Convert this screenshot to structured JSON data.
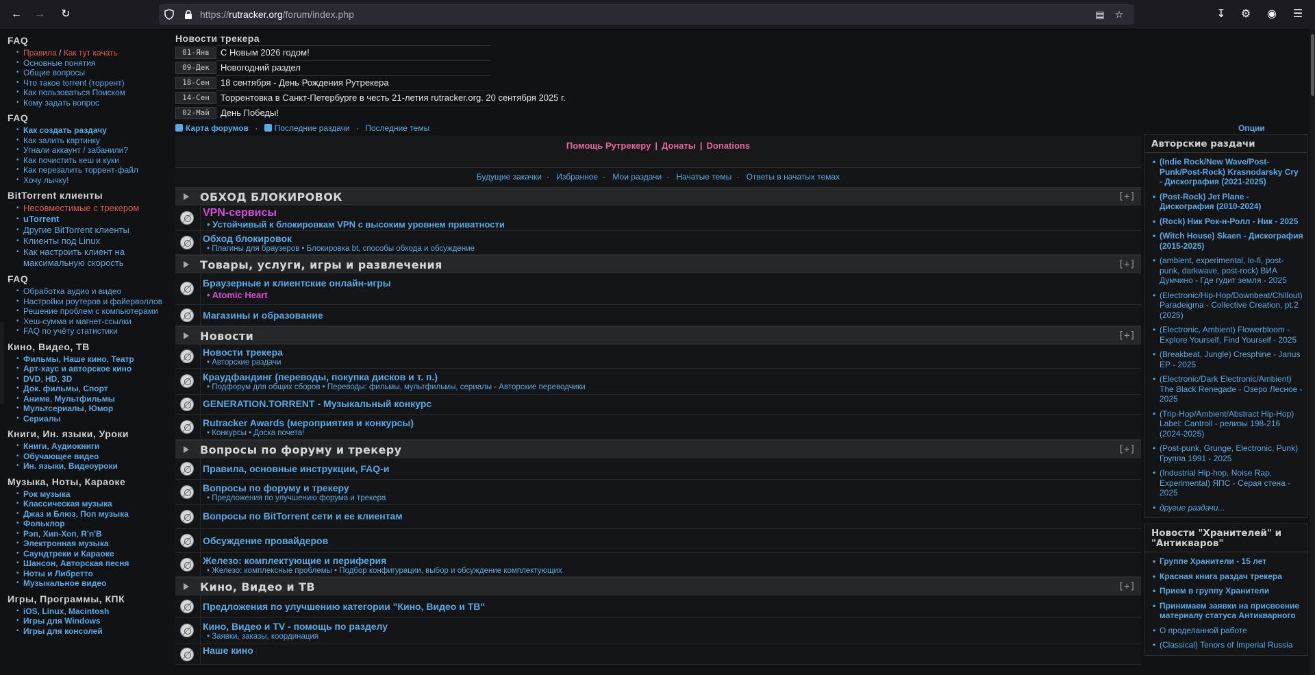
{
  "browser": {
    "url_prefix": "https://",
    "url_host": "rutracker.org",
    "url_path": "/forum/index.php"
  },
  "leftnav": {
    "faq1_title": "FAQ",
    "faq1_rules": "Правила",
    "faq1_start": "Как тут качать",
    "faq1_items": [
      "Основные понятия",
      "Общие вопросы",
      "Что такое torrent (торрент)",
      "Как пользоваться Поиском",
      "Кому задать вопрос"
    ],
    "faq2_title": "FAQ",
    "faq2_items": [
      "Как создать раздачу",
      "Как залить картинку",
      "Угнали аккаунт / забанили?",
      "Как почистить кеш и куки",
      "Как перезалить торрент-файл",
      "Хочу лычку!"
    ],
    "bt_title": "BitTorrent клиенты",
    "bt_items": [
      "Несовместимые с трекером",
      "uTorrent",
      "Другие BitTorrent клиенты",
      "Клиенты под Linux",
      "Как настроить клиент на максимальную скорость"
    ],
    "faq3_title": "FAQ",
    "faq3_items": [
      "Обработка аудио и видео",
      "Настройки роутеров и файерволлов",
      "Решение проблем с компьютерами",
      "Хеш-сумма и магнет-ссылки",
      "FAQ по учёту статистики"
    ],
    "kino_title": "Кино, Видео, ТВ",
    "kino_items": [
      [
        "Фильмы",
        "Наше кино",
        "Театр"
      ],
      [
        "Арт-хаус и авторское кино"
      ],
      [
        "DVD",
        "HD",
        "3D"
      ],
      [
        "Док. фильмы",
        "Спорт"
      ],
      [
        "Аниме",
        "Мультфильмы"
      ],
      [
        "Мультсериалы",
        "Юмор"
      ],
      [
        "Сериалы"
      ]
    ],
    "books_title": "Книги, Ин. языки, Уроки",
    "books_items": [
      [
        "Книги",
        "Аудиокниги"
      ],
      [
        "Обучающее видео"
      ],
      [
        "Ин. языки",
        "Видеоуроки"
      ]
    ],
    "music_title": "Музыка, Ноты, Караоке",
    "music_items": [
      [
        "Рок музыка"
      ],
      [
        "Классическая музыка"
      ],
      [
        "Джаз и Блюз",
        "Поп музыка"
      ],
      [
        "Фольклор"
      ],
      [
        "Рэп",
        "Хип-Хоп",
        "R'n'B"
      ],
      [
        "Электронная музыка"
      ],
      [
        "Саундтреки и Караоке"
      ],
      [
        "Шансон",
        "Авторская песня"
      ],
      [
        "Ноты и Либретто"
      ],
      [
        "Музыкальное видео"
      ]
    ],
    "games_title": "Игры, Программы, КПК",
    "games_items": [
      [
        "iOS",
        "Linux",
        "Macintosh"
      ],
      [
        "Игры для Windows"
      ],
      [
        "Игры для консолей"
      ]
    ]
  },
  "news": {
    "title": "Новости трекера",
    "items": [
      {
        "date": "01-Янв",
        "text": "С Новым 2026 годом!"
      },
      {
        "date": "09-Дек",
        "text": "Новогодний раздел"
      },
      {
        "date": "18-Сен",
        "text": "18 сентября - День Рождения Рутрекера"
      },
      {
        "date": "14-Сен",
        "text": "Торрентовка в Санкт-Петербурге в честь 21-летия rutracker.org. 20 сентября 2025 г."
      },
      {
        "date": "02-Май",
        "text": "День Победы!"
      }
    ]
  },
  "maplinks": {
    "map": "Карта форумов",
    "latest": "Последние раздачи",
    "topics": "Последние темы",
    "options": "Опции показа"
  },
  "helpbar": {
    "help": "Помощь Рутрекеру",
    "donate": "Донаты",
    "donations": "Donations"
  },
  "quicklinks": [
    "Будущие закачки",
    "Избранное",
    "Мои раздачи",
    "Начатые темы",
    "Ответы в начатых темах"
  ],
  "forum": {
    "cat1": "ОБХОД БЛОКИРОВОК",
    "vpn": "VPN-сервисы",
    "vpn_sub": "Устойчивый к блокировкам VPN с высоким уровнем приватности",
    "bypass": "Обход блокировок",
    "bypass_sub": "Плагины для браузеров • Блокировка bt, способы обхода и обсуждение",
    "cat2": "Товары, услуги, игры и развлечения",
    "games": "Браузерные и клиентские онлайн-игры",
    "games_sub": "Atomic Heart",
    "shops": "Магазины и образование",
    "cat3": "Новости",
    "trackernews": "Новости трекера",
    "trackernews_sub": "Авторские раздачи",
    "crowd": "Краудфандинг (переводы, покупка дисков и т. п.)",
    "crowd_sub": "Подфорум для общих сборов • Переводы: фильмы, мультфильмы, сериалы - Авторские переводчики",
    "gen": "GENERATION.TORRENT - Музыкальный конкурс",
    "awards": "Rutracker Awards (мероприятия и конкурсы)",
    "awards_sub": "Конкурсы • Доска почета!",
    "cat4": "Вопросы по форуму и трекеру",
    "rules": "Правила, основные инструкции, FAQ-и",
    "questions": "Вопросы по форуму и трекеру",
    "questions_sub": "Предложения по улучшению форума и трекера",
    "btq": "Вопросы по BitTorrent сети и ее клиентам",
    "prov": "Обсуждение провайдеров",
    "hw": "Железо: комплектующие и периферия",
    "hw_sub": "Железо: комплексные проблемы • Подбор конфигурации, выбор и обсуждение комплектующих",
    "cat5": "Кино, Видео и ТВ",
    "kinoprop": "Предложения по улучшению категории \"Кино, Видео и ТВ\"",
    "kinohelp": "Кино, Видео и TV - помощь по разделу",
    "kinohelp_sub": "Заявки, заказы, координация",
    "nashe": "Наше кино",
    "plus": "[+]"
  },
  "right": {
    "authors_title": "Авторские раздачи",
    "authors": [
      "(Indie Rock/New Wave/Post-Punk/Post-Rock) Krasnodarsky Cry - Дискография (2021-2025)",
      "(Post-Rock) Jet Plane - Дискография (2010-2024)",
      "(Rock) Ник Рок-н-Ролл - Ник - 2025",
      "(Witch House) Skaen - Дискография (2015-2025)",
      "(ambient, experimental, lo-fi, post-punk, darkwave, post-rock) ВИА Думчино - Где гудит земля - 2025",
      "(Electronic/Hip-Hop/Downbeat/Chillout) Paradeigma - Collective Creation, pt.2 (2025)",
      "(Electronic, Ambient) Flowerbloom - Explore Yourself, Find Yourself - 2025",
      "(Breakbeat, Jungle) Cresphine - Janus EP - 2025",
      "(Electronic/Dark Electronic/Ambient) The Black Renegade - Озеро Лесное - 2025",
      "(Trip-Hop/Ambient/Abstract Hip-Hop) Label: Cantroll - релизы 198-216 (2024-2025)",
      "(Post-punk, Grunge, Electronic, Punk) Группа 1991 - 2025",
      "(Industrial Hip-hop, Noise Rap, Experimental) ЯПС - Серая стена - 2025"
    ],
    "authors_more": "другие раздачи...",
    "keepers_title": "Новости \"Хранителей\" и \"Антикваров\"",
    "keepers": [
      "Группе Хранители - 15 лет",
      "Красная книга раздач трекера",
      "Прием в группу Хранители",
      "Принимаем заявки на присвоение материалу статуса Антикварного",
      "О проделанной работе",
      "(Classical) Tenors of Imperial Russia"
    ]
  }
}
